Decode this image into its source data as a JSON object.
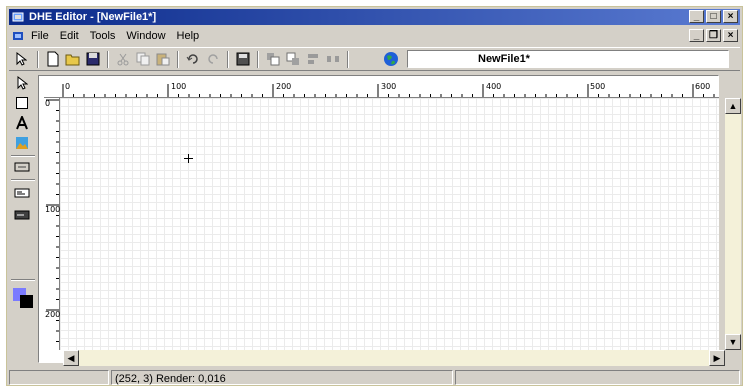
{
  "window": {
    "title": "DHE Editor - [NewFile1*]",
    "title_bar_color": "#0b2a8a",
    "buttons": [
      "minimize-icon",
      "maximize-icon",
      "close-icon"
    ]
  },
  "menu": {
    "items": [
      {
        "name": "file",
        "label": "File"
      },
      {
        "name": "edit",
        "label": "Edit"
      },
      {
        "name": "tools",
        "label": "Tools"
      },
      {
        "name": "window",
        "label": "Window"
      },
      {
        "name": "help",
        "label": "Help"
      }
    ]
  },
  "toolbar": {
    "icons": [
      "pointer-icon",
      "new-file-icon",
      "open-folder-icon",
      "save-icon",
      "cut-icon",
      "copy-icon",
      "paste-icon",
      "undo-icon",
      "redo-icon",
      "save-all-icon",
      "bring-front-icon",
      "send-back-icon",
      "align-icon",
      "distribute-icon",
      "globe-icon"
    ],
    "document_name": "NewFile1*"
  },
  "tools": [
    "select-tool-icon",
    "rectangle-tool-icon",
    "text-tool-icon",
    "image-tool-icon",
    "button-tool-icon",
    "label-tool-icon",
    "field-tool-icon"
  ],
  "colors": {
    "foreground": "#7b7bff",
    "background": "#000000"
  },
  "rulers": {
    "horizontal": [
      "0",
      "100",
      "200",
      "300",
      "400",
      "500",
      "600"
    ],
    "vertical": [
      "0",
      "100",
      "200"
    ]
  },
  "status": {
    "coords_render": "(252, 3) Render: 0,016",
    "pane2": ""
  }
}
